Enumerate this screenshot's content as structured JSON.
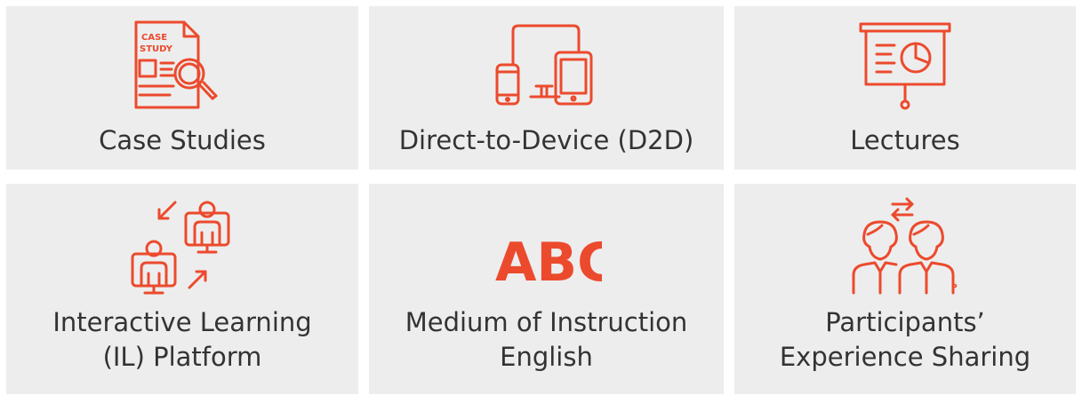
{
  "accent_color": "#ec4a2d",
  "card_background": "#ededed",
  "features": [
    {
      "icon": "case-study-icon",
      "icon_text": [
        "CASE",
        "STUDY"
      ],
      "lines": [
        "Case Studies"
      ]
    },
    {
      "icon": "devices-icon",
      "lines": [
        "Direct-to-Device (D2D)"
      ]
    },
    {
      "icon": "presentation-board-icon",
      "lines": [
        "Lectures"
      ]
    },
    {
      "icon": "interactive-learning-icon",
      "lines": [
        "Interactive Learning",
        "(IL) Platform"
      ]
    },
    {
      "icon": "abc-language-icon",
      "icon_text": "ABC",
      "lines": [
        "Medium of Instruction",
        "English"
      ]
    },
    {
      "icon": "people-exchange-icon",
      "lines": [
        "Participants’",
        "Experience Sharing"
      ]
    }
  ]
}
